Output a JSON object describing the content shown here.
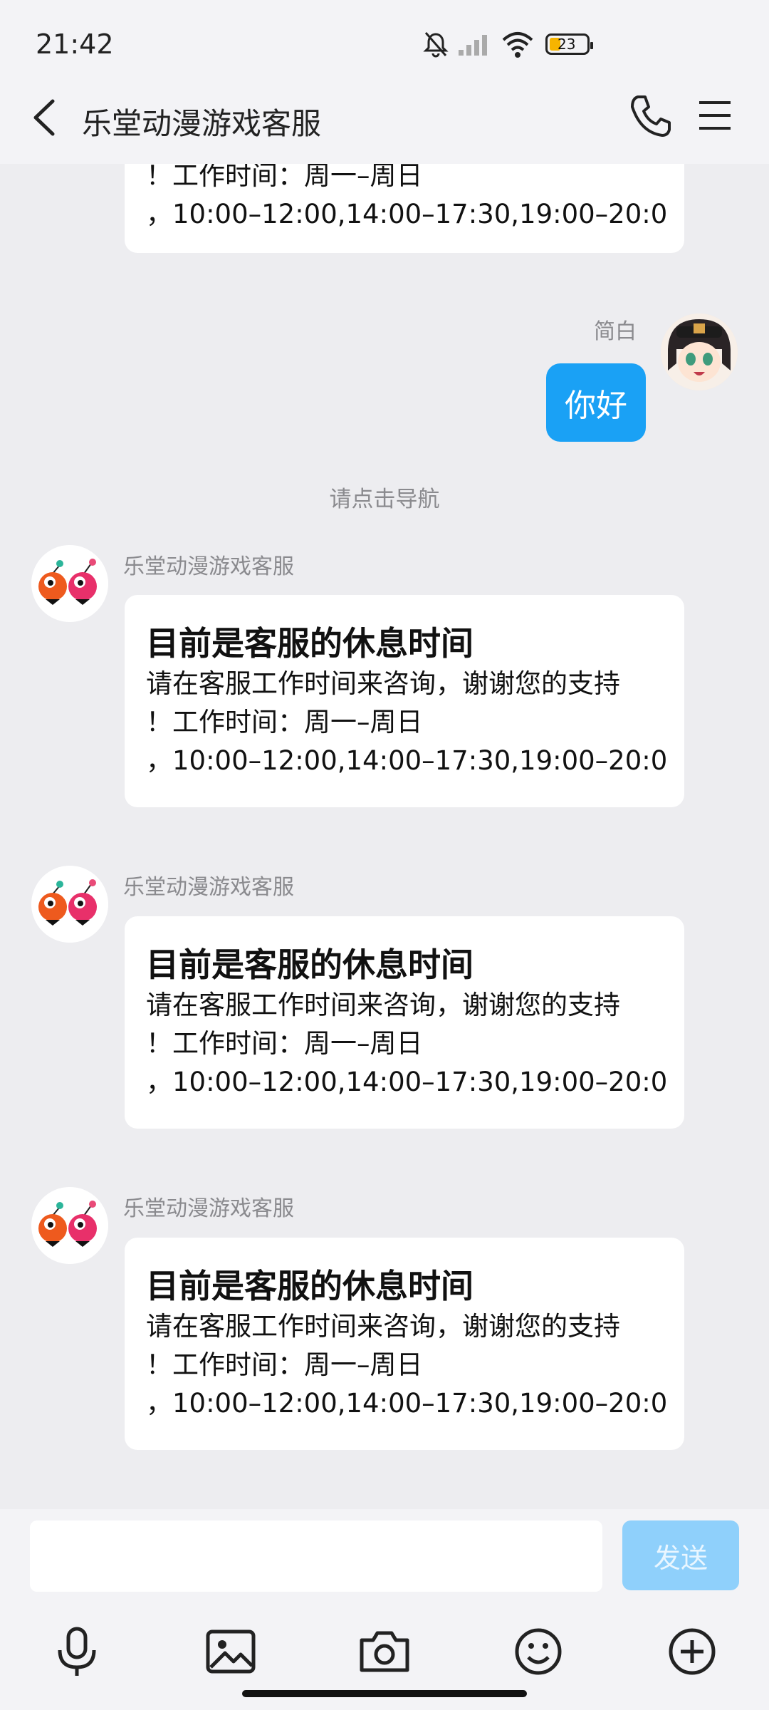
{
  "status": {
    "time": "21:42",
    "battery": "23"
  },
  "header": {
    "title": "乐堂动漫游戏客服"
  },
  "partial_message": {
    "lines": [
      "！工作时间：周一–周日",
      "，10:00–12:00,14:00–17:30,19:00–20:0"
    ]
  },
  "my_message": {
    "sender": "简白",
    "text": "你好"
  },
  "nav_hint": "请点击导航",
  "messages": [
    {
      "sender": "乐堂动漫游戏客服",
      "title": "目前是客服的休息时间",
      "lines": [
        "请在客服工作时间来咨询，谢谢您的支持",
        "！工作时间：周一–周日",
        "，10:00–12:00,14:00–17:30,19:00–20:0"
      ]
    },
    {
      "sender": "乐堂动漫游戏客服",
      "title": "目前是客服的休息时间",
      "lines": [
        "请在客服工作时间来咨询，谢谢您的支持",
        "！工作时间：周一–周日",
        "，10:00–12:00,14:00–17:30,19:00–20:0"
      ]
    },
    {
      "sender": "乐堂动漫游戏客服",
      "title": "目前是客服的休息时间",
      "lines": [
        "请在客服工作时间来咨询，谢谢您的支持",
        "！工作时间：周一–周日",
        "，10:00–12:00,14:00–17:30,19:00–20:0"
      ]
    }
  ],
  "composer": {
    "input_value": "",
    "send_label": "发送"
  },
  "toolbar_icons": [
    "microphone-icon",
    "image-icon",
    "camera-icon",
    "emoji-icon",
    "plus-icon"
  ],
  "colors": {
    "accent": "#1aa1f5",
    "send_disabled": "#8fd0fb",
    "background": "#ededf0"
  }
}
